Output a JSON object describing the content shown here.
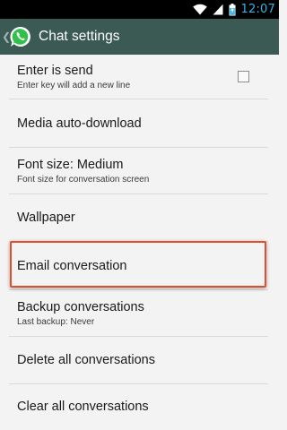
{
  "status_bar": {
    "time": "12:07",
    "icons": [
      "wifi-icon",
      "signal-icon",
      "battery-charging-icon"
    ],
    "time_color": "#33b5e5"
  },
  "action_bar": {
    "title": "Chat settings",
    "up_icon": "chevron-left-icon",
    "logo_icon": "whatsapp-logo",
    "background_color": "#3c5a54"
  },
  "settings": {
    "enter_is_send": {
      "title": "Enter is send",
      "summary": "Enter key will add a new line",
      "checked": false
    },
    "media_auto_download": {
      "title": "Media auto-download"
    },
    "font_size": {
      "title": "Font size: Medium",
      "summary": "Font size for conversation screen"
    },
    "wallpaper": {
      "title": "Wallpaper"
    },
    "email_conversation": {
      "title": "Email conversation",
      "highlighted": true
    },
    "backup_conversations": {
      "title": "Backup conversations",
      "summary": "Last backup: Never"
    },
    "delete_all_conversations": {
      "title": "Delete all conversations"
    },
    "clear_all_conversations": {
      "title": "Clear all conversations"
    }
  },
  "colors": {
    "highlight_border": "#e04e2e",
    "list_background": "#f3f3f3"
  }
}
